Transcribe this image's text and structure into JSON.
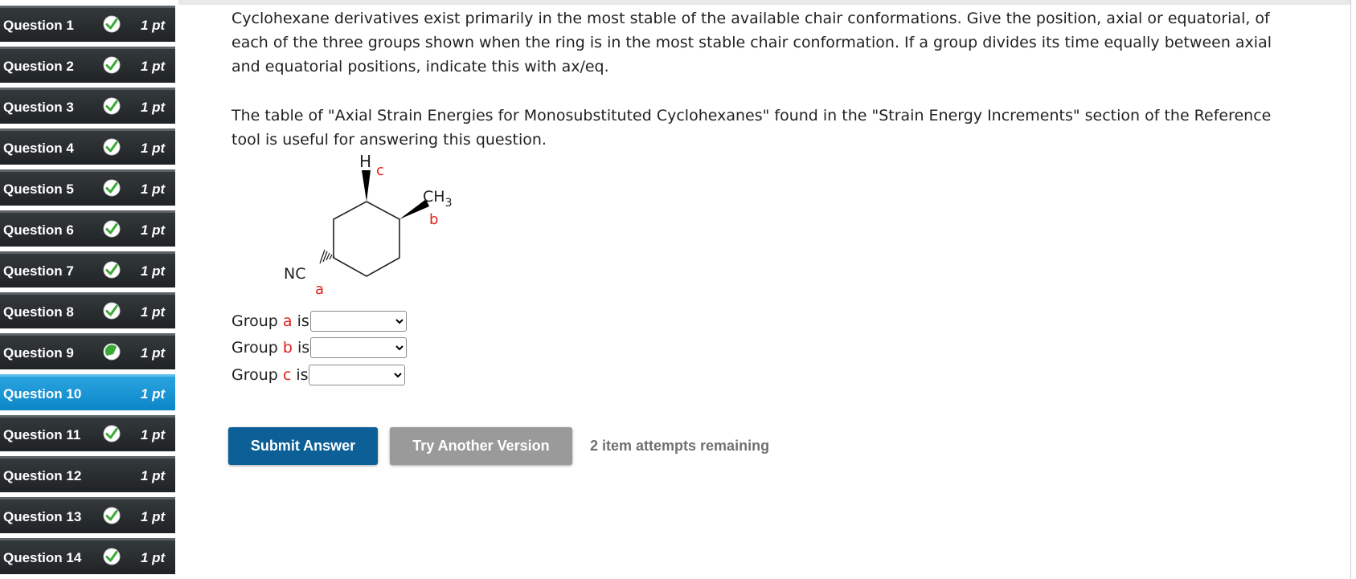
{
  "sidebar": {
    "questions": [
      {
        "label": "Question 1",
        "points": "1 pt",
        "status": "correct"
      },
      {
        "label": "Question 2",
        "points": "1 pt",
        "status": "correct"
      },
      {
        "label": "Question 3",
        "points": "1 pt",
        "status": "correct"
      },
      {
        "label": "Question 4",
        "points": "1 pt",
        "status": "correct"
      },
      {
        "label": "Question 5",
        "points": "1 pt",
        "status": "correct"
      },
      {
        "label": "Question 6",
        "points": "1 pt",
        "status": "correct"
      },
      {
        "label": "Question 7",
        "points": "1 pt",
        "status": "correct"
      },
      {
        "label": "Question 8",
        "points": "1 pt",
        "status": "correct"
      },
      {
        "label": "Question 9",
        "points": "1 pt",
        "status": "partial"
      },
      {
        "label": "Question 10",
        "points": "1 pt",
        "status": "current"
      },
      {
        "label": "Question 11",
        "points": "1 pt",
        "status": "correct"
      },
      {
        "label": "Question 12",
        "points": "1 pt",
        "status": "none"
      },
      {
        "label": "Question 13",
        "points": "1 pt",
        "status": "correct"
      },
      {
        "label": "Question 14",
        "points": "1 pt",
        "status": "correct"
      }
    ]
  },
  "question": {
    "paragraph1": "Cyclohexane derivatives exist primarily in the most stable of the available chair conformations. Give the position, axial or equatorial, of each of the three groups shown when the ring is in the most stable chair conformation. If a group divides its time equally between axial and equatorial positions, indicate this with ax/eq.",
    "paragraph2": "The table of \"Axial Strain Energies for Monosubstituted Cyclohexanes\" found in the \"Strain Energy Increments\" section of the Reference tool is useful for answering this question."
  },
  "molecule": {
    "h_label": "H",
    "label_c": "c",
    "ch3_main": "CH",
    "ch3_sub": "3",
    "label_b": "b",
    "nc_label": "NC",
    "label_a": "a"
  },
  "groups": [
    {
      "prefix": "Group ",
      "letter": "a",
      "suffix": " is",
      "selected": ""
    },
    {
      "prefix": "Group ",
      "letter": "b",
      "suffix": " is",
      "selected": ""
    },
    {
      "prefix": "Group ",
      "letter": "c",
      "suffix": " is",
      "selected": ""
    }
  ],
  "actions": {
    "submit_label": "Submit Answer",
    "try_another_label": "Try Another Version",
    "attempts_text": "2 item attempts remaining"
  },
  "colors": {
    "check_green": "#3aa935",
    "active_blue": "#1795d6",
    "submit_blue": "#0d5f98",
    "label_red": "#e0211b"
  }
}
